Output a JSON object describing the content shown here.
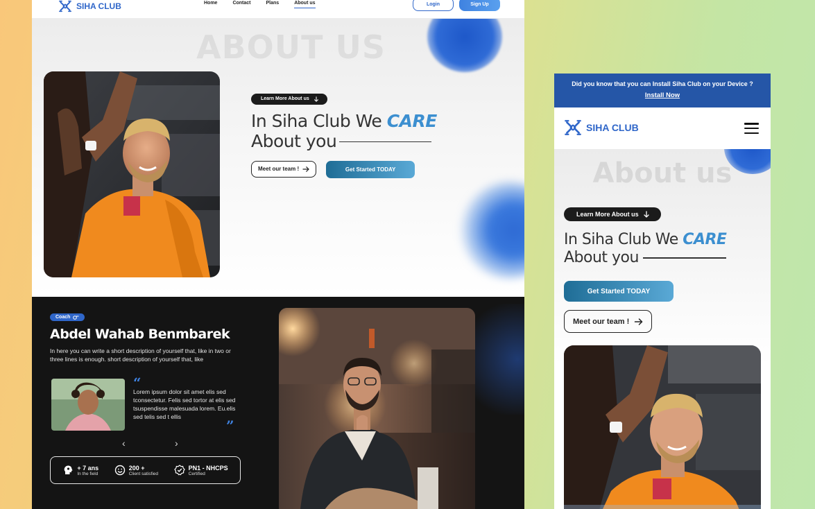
{
  "brand": {
    "name": "SIHA CLUB",
    "color": "#2f66c9"
  },
  "desktop": {
    "nav": {
      "links": [
        {
          "label": "Home"
        },
        {
          "label": "Contact"
        },
        {
          "label": "Plans"
        },
        {
          "label": "About us",
          "active": true
        }
      ],
      "login_label": "Login",
      "signup_label": "Sign Up"
    },
    "hero": {
      "ghost_title": "ABOUT US",
      "pill_label": "Learn More About us",
      "heading_prefix": "In Siha Club We",
      "heading_emphasis": "CARE",
      "heading_line2": "About you",
      "team_button": "Meet our team !",
      "cta_button": "Get Started TODAY"
    },
    "coach": {
      "badge": "Coach",
      "name": "Abdel Wahab Benmbarek",
      "description": "In here you can write a short description of yourself that, like in two or three lines is enough. short description of yourself that, like",
      "testimonial": "Lorem ipsum dolor sit amet  elis sed tconsectetur. Felis sed tortor at elis sed tsuspendisse malesuada lorem. Eu.elis sed telis sed t ellis",
      "stats": [
        {
          "value": "+ 7 ans",
          "label": "In the field",
          "icon": "head-icon"
        },
        {
          "value": "200 +",
          "label": "Client satisfied",
          "icon": "smile-icon"
        },
        {
          "value": "PN1 - NHCPS",
          "label": "Certified",
          "icon": "verified-icon"
        }
      ]
    }
  },
  "mobile": {
    "banner_text": "Did you know that you can Install Siha Club on your Device ?",
    "banner_link": "Install Now",
    "ghost_title": "About us",
    "pill_label": "Learn More About us",
    "heading_prefix": "In Siha Club We",
    "heading_emphasis": "CARE",
    "heading_line2": "About you",
    "cta_button": "Get Started TODAY",
    "team_button": "Meet our team !"
  }
}
